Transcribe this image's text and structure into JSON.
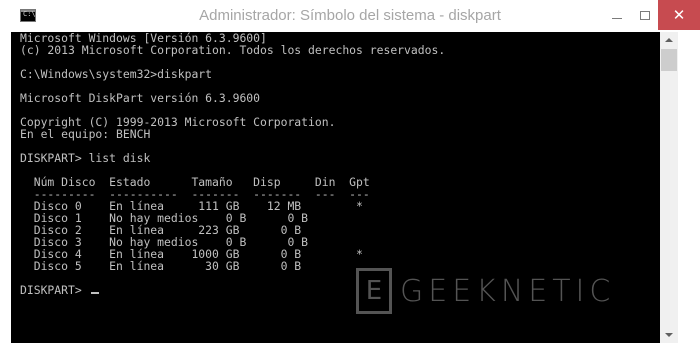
{
  "window": {
    "title": "Administrador: Símbolo del sistema - diskpart",
    "icon_label": "C:\\",
    "close_glyph": "✕"
  },
  "console": {
    "lines": [
      "Microsoft Windows [Versión 6.3.9600]",
      "(c) 2013 Microsoft Corporation. Todos los derechos reservados.",
      "",
      "C:\\Windows\\system32>diskpart",
      "",
      "Microsoft DiskPart versión 6.3.9600",
      "",
      "Copyright (C) 1999-2013 Microsoft Corporation.",
      "En el equipo: BENCH",
      "",
      "DISKPART> list disk",
      "",
      "  Núm Disco  Estado      Tamaño   Disp     Din  Gpt",
      "  ---------  ----------  -------  -------  ---  ---",
      "  Disco 0    En línea     111 GB    12 MB        *",
      "  Disco 1    No hay medios    0 B      0 B",
      "  Disco 2    En línea     223 GB      0 B",
      "  Disco 3    No hay medios    0 B      0 B",
      "  Disco 4    En línea    1000 GB      0 B        *",
      "  Disco 5    En línea      30 GB      0 B",
      "",
      "DISKPART> "
    ]
  },
  "watermark": {
    "logo_letter": "E",
    "text": "GEEKNETIC"
  },
  "colors": {
    "console_bg": "#000000",
    "console_fg": "#c0c0c0",
    "close_button": "#c74b50",
    "title_text": "#a6a6a6"
  }
}
